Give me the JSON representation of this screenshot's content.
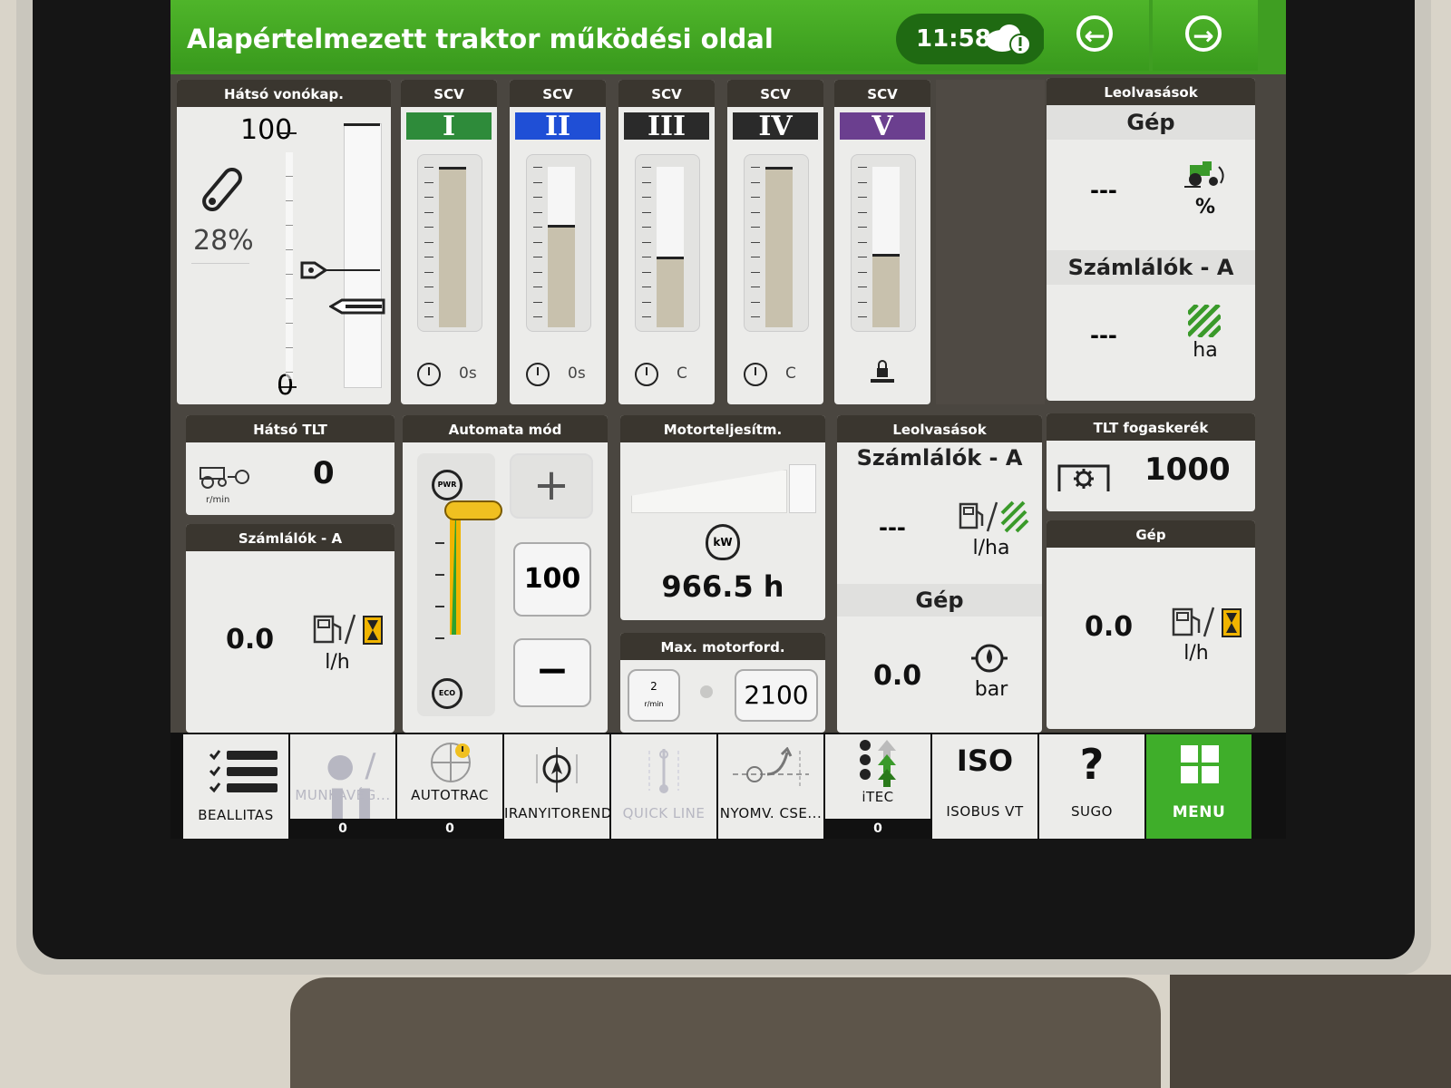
{
  "header": {
    "title": "Alapértelmezett traktor működési oldal",
    "time": "11:58"
  },
  "rear_hitch": {
    "title": "Hátsó vonókap.",
    "max": "100",
    "min": "0",
    "percent": "28%",
    "position_fraction": 0.28
  },
  "scv": [
    {
      "title": "SCV",
      "roman": "I",
      "color": "#2e8b3a",
      "timer": "0s",
      "level": 1.0
    },
    {
      "title": "SCV",
      "roman": "II",
      "color": "#1f4fd6",
      "timer": "0s",
      "level": 0.63
    },
    {
      "title": "SCV",
      "roman": "III",
      "color": "#2a2a2a",
      "timer": "C",
      "level": 0.43
    },
    {
      "title": "SCV",
      "roman": "IV",
      "color": "#2a2a2a",
      "timer": "C",
      "level": 1.0
    },
    {
      "title": "SCV",
      "roman": "V",
      "color": "#6b3f8f",
      "timer": "",
      "level": 0.45
    }
  ],
  "readings_top": {
    "title": "Leolvasások",
    "section1": "Gép",
    "value1": "---",
    "unit1": "%",
    "section2": "Számlálók - A",
    "value2": "---",
    "unit2": "ha"
  },
  "rear_pto": {
    "title": "Hátsó TLT",
    "value": "0",
    "unit": "r/min"
  },
  "counters_a": {
    "title": "Számlálók - A",
    "value": "0.0",
    "unit": "l/h"
  },
  "auto_mode": {
    "title": "Automata mód",
    "top_label": "PWR",
    "bottom_label": "ECO",
    "value": "100",
    "plus": "+",
    "minus": "−"
  },
  "engine_power": {
    "title": "Motorteljesítm.",
    "icon_label": "kW",
    "hours": "966.5 h"
  },
  "max_rpm": {
    "title": "Max. motorford.",
    "value": "2100",
    "icon_label": "2",
    "icon_unit": "r/min"
  },
  "readings_mid": {
    "title": "Leolvasások",
    "section1": "Számlálók - A",
    "value1": "---",
    "unit1": "l/ha",
    "section2": "Gép",
    "value2": "0.0",
    "unit2": "bar"
  },
  "pto_gear": {
    "title": "TLT fogaskerék",
    "value": "1000"
  },
  "machine": {
    "title": "Gép",
    "value": "0.0",
    "unit": "l/h"
  },
  "softkeys": [
    {
      "label": "BEALLITAS",
      "count": ""
    },
    {
      "label": "MUNKAVÉG...",
      "count": "0"
    },
    {
      "label": "AUTOTRAC",
      "count": "0"
    },
    {
      "label": "IRANYITOREND",
      "count": ""
    },
    {
      "label": "QUICK LINE",
      "count": ""
    },
    {
      "label": "NYOMV. CSE...",
      "count": ""
    },
    {
      "label": "iTEC",
      "count": "0"
    },
    {
      "label": "ISOBUS VT",
      "count": "",
      "logo": "ISO"
    },
    {
      "label": "SUGO",
      "count": "",
      "glyph": "?"
    },
    {
      "label": "MENU",
      "count": ""
    }
  ],
  "colors": {
    "header_green": "#4fb52a",
    "menu_green": "#3fae2a",
    "module_title": "#3a362f",
    "eco_yellow": "#f0b400"
  }
}
